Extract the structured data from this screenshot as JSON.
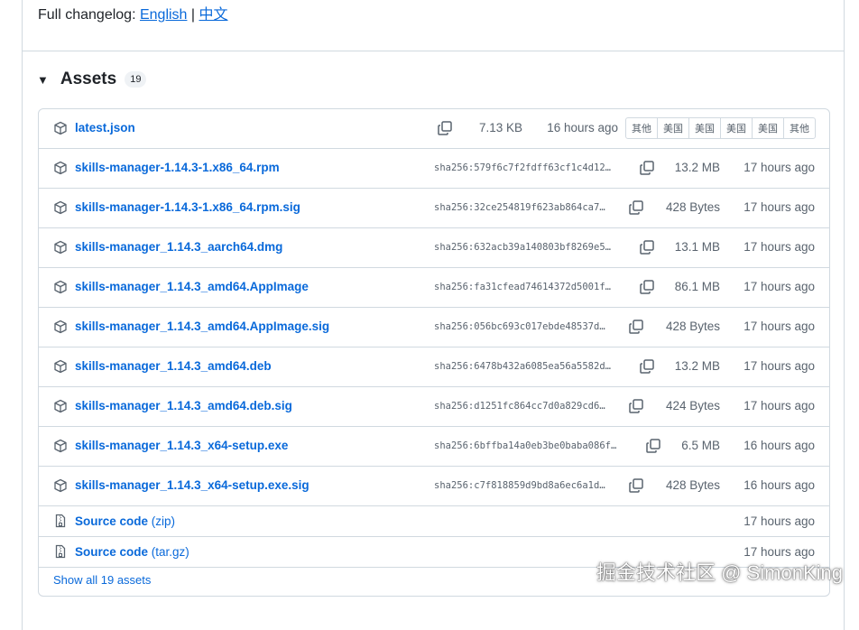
{
  "changelog": {
    "label": "Full changelog:",
    "english": "English",
    "sep": "|",
    "chinese": "中文"
  },
  "assets": {
    "title": "Assets",
    "count": "19",
    "show_all": "Show all 19 assets"
  },
  "first": {
    "name": "latest.json",
    "size": "7.13 KB",
    "time": "16 hours ago",
    "badges": [
      "其他",
      "美国",
      "美国",
      "美国",
      "美国",
      "其他"
    ]
  },
  "rows": [
    {
      "name": "skills-manager-1.14.3-1.x86_64.rpm",
      "sha": "sha256:579f6c7f2fdff63cf1c4d12…",
      "size": "13.2 MB",
      "time": "17 hours ago"
    },
    {
      "name": "skills-manager-1.14.3-1.x86_64.rpm.sig",
      "sha": "sha256:32ce254819f623ab864ca7…",
      "size": "428 Bytes",
      "time": "17 hours ago"
    },
    {
      "name": "skills-manager_1.14.3_aarch64.dmg",
      "sha": "sha256:632acb39a140803bf8269e5…",
      "size": "13.1 MB",
      "time": "17 hours ago"
    },
    {
      "name": "skills-manager_1.14.3_amd64.AppImage",
      "sha": "sha256:fa31cfead74614372d5001f…",
      "size": "86.1 MB",
      "time": "17 hours ago"
    },
    {
      "name": "skills-manager_1.14.3_amd64.AppImage.sig",
      "sha": "sha256:056bc693c017ebde48537d…",
      "size": "428 Bytes",
      "time": "17 hours ago"
    },
    {
      "name": "skills-manager_1.14.3_amd64.deb",
      "sha": "sha256:6478b432a6085ea56a5582d…",
      "size": "13.2 MB",
      "time": "17 hours ago"
    },
    {
      "name": "skills-manager_1.14.3_amd64.deb.sig",
      "sha": "sha256:d1251fc864cc7d0a829cd6…",
      "size": "424 Bytes",
      "time": "17 hours ago"
    },
    {
      "name": "skills-manager_1.14.3_x64-setup.exe",
      "sha": "sha256:6bffba14a0eb3be0baba086f…",
      "size": "6.5 MB",
      "time": "16 hours ago"
    },
    {
      "name": "skills-manager_1.14.3_x64-setup.exe.sig",
      "sha": "sha256:c7f818859d9bd8a6ec6a1d…",
      "size": "428 Bytes",
      "time": "16 hours ago"
    }
  ],
  "sources": [
    {
      "name": "Source code",
      "ext": "(zip)",
      "time": "17 hours ago"
    },
    {
      "name": "Source code",
      "ext": "(tar.gz)",
      "time": "17 hours ago"
    }
  ],
  "watermark": "掘金技术社区 @ SimonKing"
}
